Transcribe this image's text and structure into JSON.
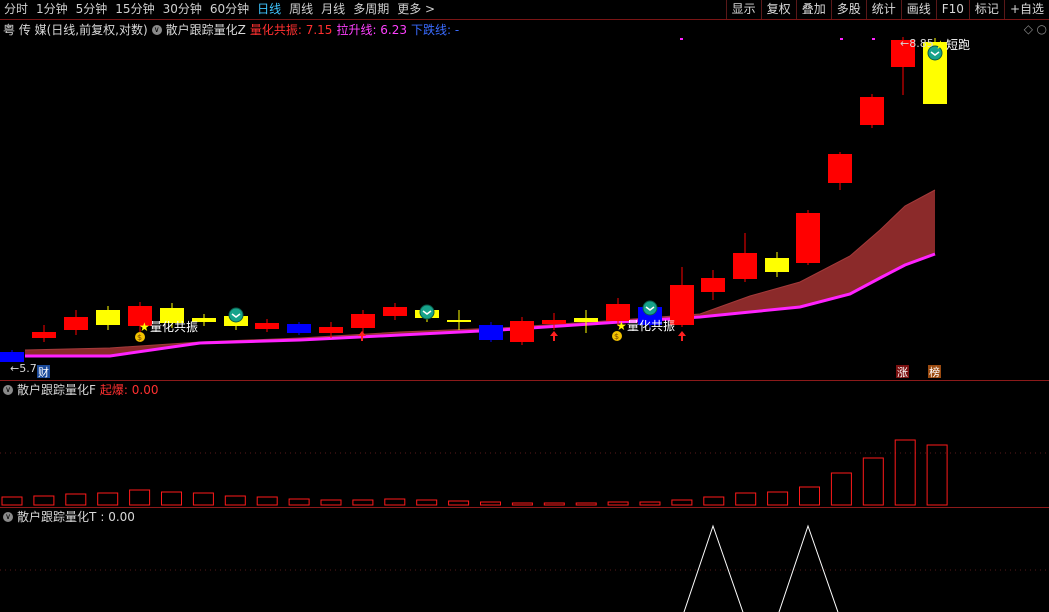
{
  "toolbar": {
    "tabs": [
      "分时",
      "1分钟",
      "5分钟",
      "15分钟",
      "30分钟",
      "60分钟",
      "日线",
      "周线",
      "月线",
      "多周期",
      "更多 >"
    ],
    "active_index": 6,
    "right_buttons": [
      "显示",
      "复权",
      "叠加",
      "多股",
      "统计",
      "画线",
      "F10",
      "标记",
      "+自选"
    ]
  },
  "main": {
    "stock_title": "粤 传 媒(日线,前复权,对数)",
    "indicator_name": "散户跟踪量化Z",
    "resonance_label": "量化共振: 7.15",
    "lift_label": "拉升线: 6.23",
    "down_label": "下跌线: -",
    "price_high": "8.85",
    "price_low": "5.7",
    "signal_resonance": "量化共振",
    "signal_run": "短跑",
    "tag_cai": "财",
    "tag_zhang": "涨",
    "tag_bang": "榜",
    "colors": {
      "up": "#ff0000",
      "down": "#0000ff",
      "doji": "#ffff00",
      "band": "#8b2a2a",
      "lift_line": "#ff22ff"
    }
  },
  "sub1": {
    "indicator_name": "散户跟踪量化F",
    "value_label": "起爆: 0.00"
  },
  "sub2": {
    "indicator_name": "散户跟踪量化T",
    "value_label": ": 0.00"
  }
}
